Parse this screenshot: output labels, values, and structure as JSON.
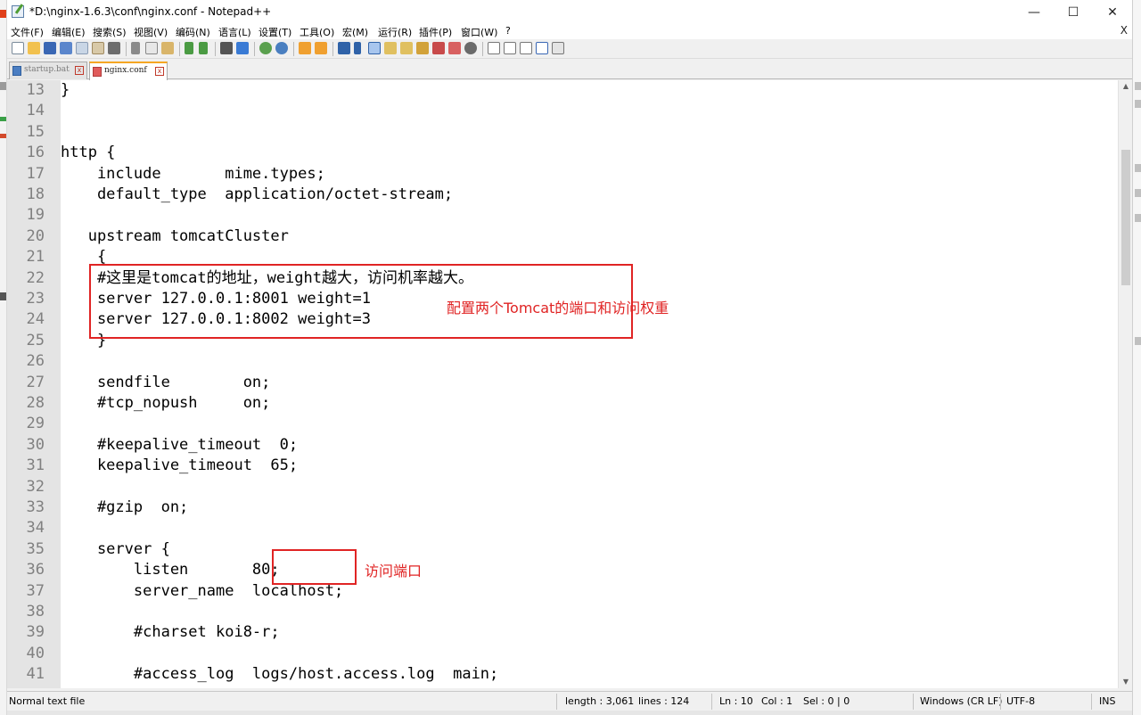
{
  "window": {
    "title": "*D:\\nginx-1.6.3\\conf\\nginx.conf - Notepad++",
    "minimize": "—",
    "maximize": "☐",
    "close": "✕"
  },
  "menu": {
    "items": [
      "文件(F)",
      "编辑(E)",
      "搜索(S)",
      "视图(V)",
      "编码(N)",
      "语言(L)",
      "设置(T)",
      "工具(O)",
      "宏(M)",
      "运行(R)",
      "插件(P)",
      "窗口(W)",
      "?"
    ],
    "close_doc": "X"
  },
  "toolbar": {
    "icons": [
      "new-file-icon",
      "open-file-icon",
      "save-icon",
      "save-all-icon",
      "close-icon",
      "close-all-icon",
      "print-icon",
      "cut-icon",
      "copy-icon",
      "paste-icon",
      "undo-icon",
      "redo-icon",
      "find-icon",
      "replace-icon",
      "zoom-in-icon",
      "zoom-out-icon",
      "sync-vertical-icon",
      "sync-horizontal-icon",
      "word-wrap-icon",
      "show-all-chars-icon",
      "indent-guide-icon",
      "user-language-icon",
      "doc-map-icon",
      "function-list-icon",
      "folder-workspace-icon",
      "monitor-icon",
      "record-macro-icon",
      "stop-macro-icon",
      "play-macro-icon",
      "run-macro-multiple-icon",
      "save-macro-icon"
    ]
  },
  "tabs": [
    {
      "label": "startup.bat",
      "active": false
    },
    {
      "label": "nginx.conf",
      "active": true
    }
  ],
  "editor": {
    "lines": [
      {
        "num": "13",
        "text": "}"
      },
      {
        "num": "14",
        "text": ""
      },
      {
        "num": "15",
        "text": ""
      },
      {
        "num": "16",
        "text": "http {"
      },
      {
        "num": "17",
        "text": "    include       mime.types;"
      },
      {
        "num": "18",
        "text": "    default_type  application/octet-stream;"
      },
      {
        "num": "19",
        "text": ""
      },
      {
        "num": "20",
        "text": "   upstream tomcatCluster"
      },
      {
        "num": "21",
        "text": "    {"
      },
      {
        "num": "22",
        "text": "    #这里是tomcat的地址，weight越大，访问机率越大。"
      },
      {
        "num": "23",
        "text": "    server 127.0.0.1:8001 weight=1"
      },
      {
        "num": "24",
        "text": "    server 127.0.0.1:8002 weight=3"
      },
      {
        "num": "25",
        "text": "    }"
      },
      {
        "num": "26",
        "text": ""
      },
      {
        "num": "27",
        "text": "    sendfile        on;"
      },
      {
        "num": "28",
        "text": "    #tcp_nopush     on;"
      },
      {
        "num": "29",
        "text": ""
      },
      {
        "num": "30",
        "text": "    #keepalive_timeout  0;"
      },
      {
        "num": "31",
        "text": "    keepalive_timeout  65;"
      },
      {
        "num": "32",
        "text": ""
      },
      {
        "num": "33",
        "text": "    #gzip  on;"
      },
      {
        "num": "34",
        "text": ""
      },
      {
        "num": "35",
        "text": "    server {"
      },
      {
        "num": "36",
        "text": "        listen       80;"
      },
      {
        "num": "37",
        "text": "        server_name  localhost;"
      },
      {
        "num": "38",
        "text": ""
      },
      {
        "num": "39",
        "text": "        #charset koi8-r;"
      },
      {
        "num": "40",
        "text": ""
      },
      {
        "num": "41",
        "text": "        #access_log  logs/host.access.log  main;"
      }
    ]
  },
  "annotations": [
    {
      "text": "配置两个Tomcat的端口和访问权重"
    },
    {
      "text": "访问端口"
    }
  ],
  "status": {
    "file_type": "Normal text file",
    "length": "length : 3,061",
    "lines": "lines : 124",
    "ln": "Ln : 10",
    "col": "Col : 1",
    "sel": "Sel : 0 | 0",
    "eol": "Windows (CR LF)",
    "encoding": "UTF-8",
    "mode": "INS"
  },
  "colors": {
    "annotation": "#e02424",
    "gutter": "#e4e4e4",
    "active_tab_accent": "#f5a623"
  }
}
